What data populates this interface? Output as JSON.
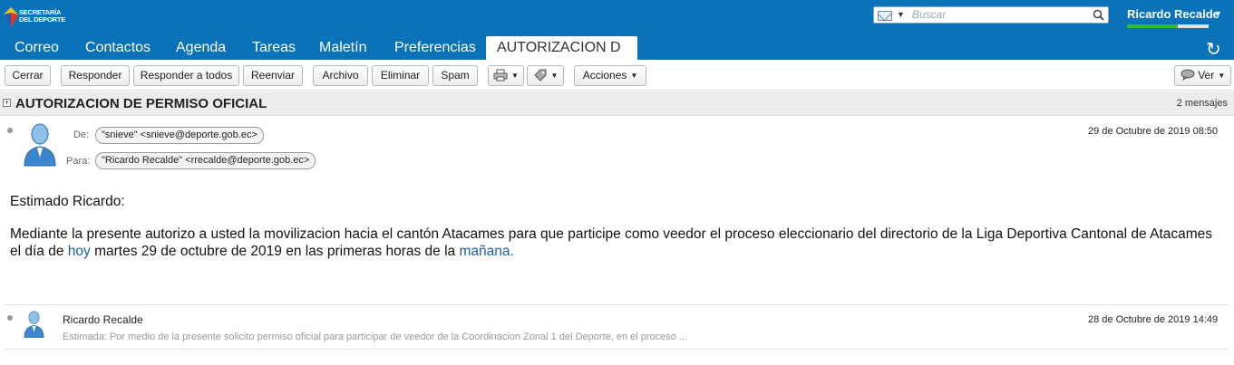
{
  "app": {
    "logo_text_1": "SECRETARÍA",
    "logo_text_2": "DEL DEPORTE",
    "search_placeholder": "Buscar",
    "user_name": "Ricardo Recalde",
    "quota_fraction": 0.62,
    "accent_color": "#0972b8"
  },
  "tabs": [
    {
      "label": "Correo"
    },
    {
      "label": "Contactos"
    },
    {
      "label": "Agenda"
    },
    {
      "label": "Tareas"
    },
    {
      "label": "Maletín"
    },
    {
      "label": "Preferencias"
    },
    {
      "label": "AUTORIZACION D",
      "active": true
    }
  ],
  "toolbar": {
    "close": "Cerrar",
    "reply": "Responder",
    "reply_all": "Responder a todos",
    "forward": "Reenviar",
    "archive": "Archivo",
    "delete": "Eliminar",
    "spam": "Spam",
    "actions": "Acciones",
    "view": "Ver"
  },
  "conversation": {
    "subject": "AUTORIZACION DE PERMISO OFICIAL",
    "count": "2 mensajes"
  },
  "message1": {
    "from_label": "De:",
    "from": "\"snieve\" <snieve@deporte.gob.ec>",
    "to_label": "Para:",
    "to": "\"Ricardo Recalde\" <rrecalde@deporte.gob.ec>",
    "date": "29 de Octubre de 2019 08:50",
    "greeting": "Estimado Ricardo:",
    "body_part1": "Mediante la presente autorizo a usted la movilizacion hacia el cantón Atacames  para que participe como veedor el proceso eleccionario del directorio de la Liga Deportiva Cantonal de Atacames el día de ",
    "body_link1": "hoy",
    "body_part2": " martes 29 de octubre de 2019 en las primeras horas de la ",
    "body_link2": "mañana."
  },
  "message2": {
    "from": "Ricardo Recalde",
    "date": "28 de Octubre de 2019 14:49",
    "snippet": "Estimada: Por medio de la presente solicito permiso oficial para participar de veedor de la Coordinacion Zonal 1 del Deporte, en el proceso ..."
  }
}
